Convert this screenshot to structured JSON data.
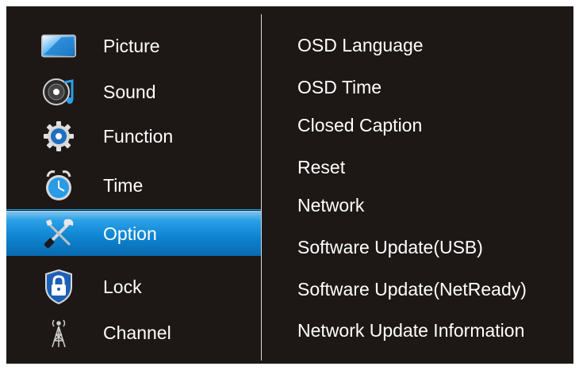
{
  "sidebar": {
    "items": [
      {
        "label": "Picture",
        "icon": "picture-icon"
      },
      {
        "label": "Sound",
        "icon": "sound-icon"
      },
      {
        "label": "Function",
        "icon": "gear-icon"
      },
      {
        "label": "Time",
        "icon": "clock-icon"
      },
      {
        "label": "Option",
        "icon": "tools-icon",
        "selected": true
      },
      {
        "label": "Lock",
        "icon": "lock-shield-icon"
      },
      {
        "label": "Channel",
        "icon": "antenna-icon"
      }
    ]
  },
  "options": {
    "items": [
      {
        "label": "OSD Language"
      },
      {
        "label": "OSD Time"
      },
      {
        "label": "Closed Caption"
      },
      {
        "label": "Reset"
      },
      {
        "label": "Network"
      },
      {
        "label": "Software Update(USB)"
      },
      {
        "label": "Software Update(NetReady)"
      },
      {
        "label": "Network Update Information"
      }
    ]
  },
  "colors": {
    "background": "#1d1816",
    "highlight": "#0f86d3",
    "text": "#ffffff"
  }
}
